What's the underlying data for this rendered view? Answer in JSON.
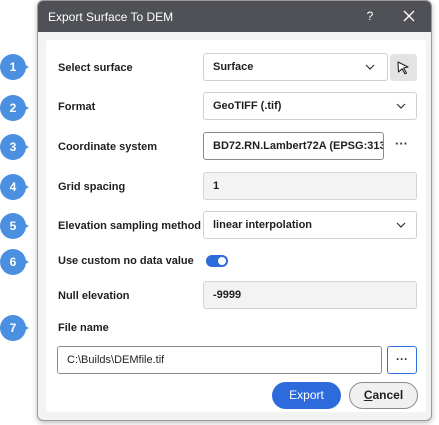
{
  "dialog": {
    "title": "Export Surface To DEM",
    "help_label": "?"
  },
  "callouts": [
    "1",
    "2",
    "3",
    "4",
    "5",
    "6",
    "7"
  ],
  "fields": {
    "surface": {
      "label": "Select surface",
      "value": "Surface"
    },
    "format": {
      "label": "Format",
      "value": "GeoTIFF (.tif)"
    },
    "coordinate_system": {
      "label": "Coordinate system",
      "value": "BD72.RN.Lambert72A (EPSG:313"
    },
    "grid_spacing": {
      "label": "Grid spacing",
      "value": "1"
    },
    "elevation_sampling": {
      "label": "Elevation sampling method",
      "value": "linear interpolation"
    },
    "custom_no_data": {
      "label": "Use custom no data value",
      "checked": true
    },
    "null_elevation": {
      "label": "Null elevation",
      "value": "-9999"
    },
    "file_name": {
      "label": "File name",
      "value": "C:\\Builds\\DEMfile.tif"
    }
  },
  "browse_label": "···",
  "buttons": {
    "export": "Export",
    "cancel_underlined": "C",
    "cancel_rest": "ancel"
  },
  "colors": {
    "titlebar": "#4f5157",
    "accent": "#2d6bdc",
    "callout": "#4a8fe0"
  }
}
